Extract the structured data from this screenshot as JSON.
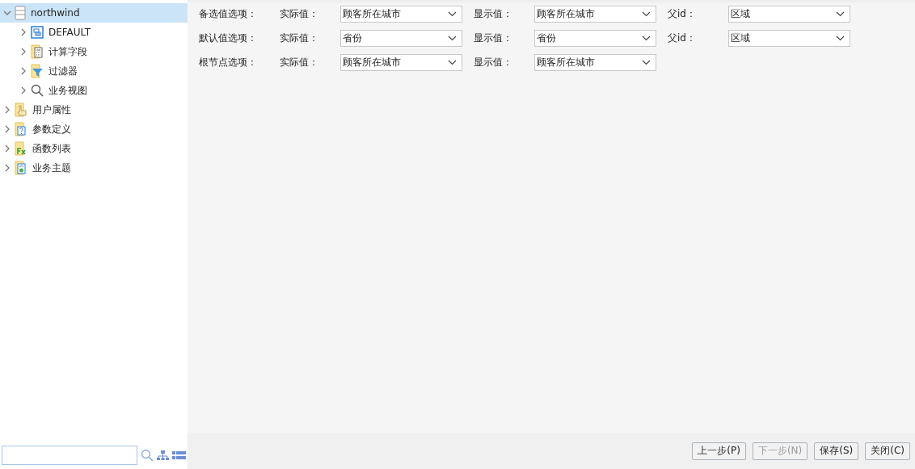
{
  "tree": [
    {
      "label": "northwind",
      "kind": "database",
      "expanded": true,
      "selected": true,
      "children": [
        {
          "label": "DEFAULT",
          "kind": "schema",
          "expanded": false,
          "selected": false
        },
        {
          "label": "计算字段",
          "kind": "calculator",
          "expanded": false,
          "selected": false
        },
        {
          "label": "过滤器",
          "kind": "filter",
          "expanded": false,
          "selected": false
        },
        {
          "label": "业务视图",
          "kind": "view",
          "expanded": false,
          "selected": false
        }
      ]
    },
    {
      "label": "用户属性",
      "kind": "hand",
      "expanded": false,
      "selected": false
    },
    {
      "label": "参数定义",
      "kind": "param",
      "expanded": false,
      "selected": false
    },
    {
      "label": "函数列表",
      "kind": "function",
      "expanded": false,
      "selected": false
    },
    {
      "label": "业务主题",
      "kind": "topic",
      "expanded": false,
      "selected": false
    }
  ],
  "options": [
    {
      "label": "备选值选项：",
      "fields": [
        {
          "label": "实际值：",
          "value": "顾客所在城市"
        },
        {
          "label": "显示值：",
          "value": "顾客所在城市"
        },
        {
          "label": "父id：",
          "value": "区域"
        }
      ]
    },
    {
      "label": "默认值选项：",
      "fields": [
        {
          "label": "实际值：",
          "value": "省份"
        },
        {
          "label": "显示值：",
          "value": "省份"
        },
        {
          "label": "父id：",
          "value": "区域"
        }
      ]
    },
    {
      "label": "根节点选项：",
      "fields": [
        {
          "label": "实际值：",
          "value": "顾客所在城市"
        },
        {
          "label": "显示值：",
          "value": "顾客所在城市"
        }
      ]
    }
  ],
  "buttons": [
    {
      "label": "上一步(P)",
      "disabled": false
    },
    {
      "label": "下一步(N)",
      "disabled": true
    },
    {
      "label": "保存(S)",
      "disabled": false
    },
    {
      "label": "关闭(C)",
      "disabled": false
    }
  ]
}
